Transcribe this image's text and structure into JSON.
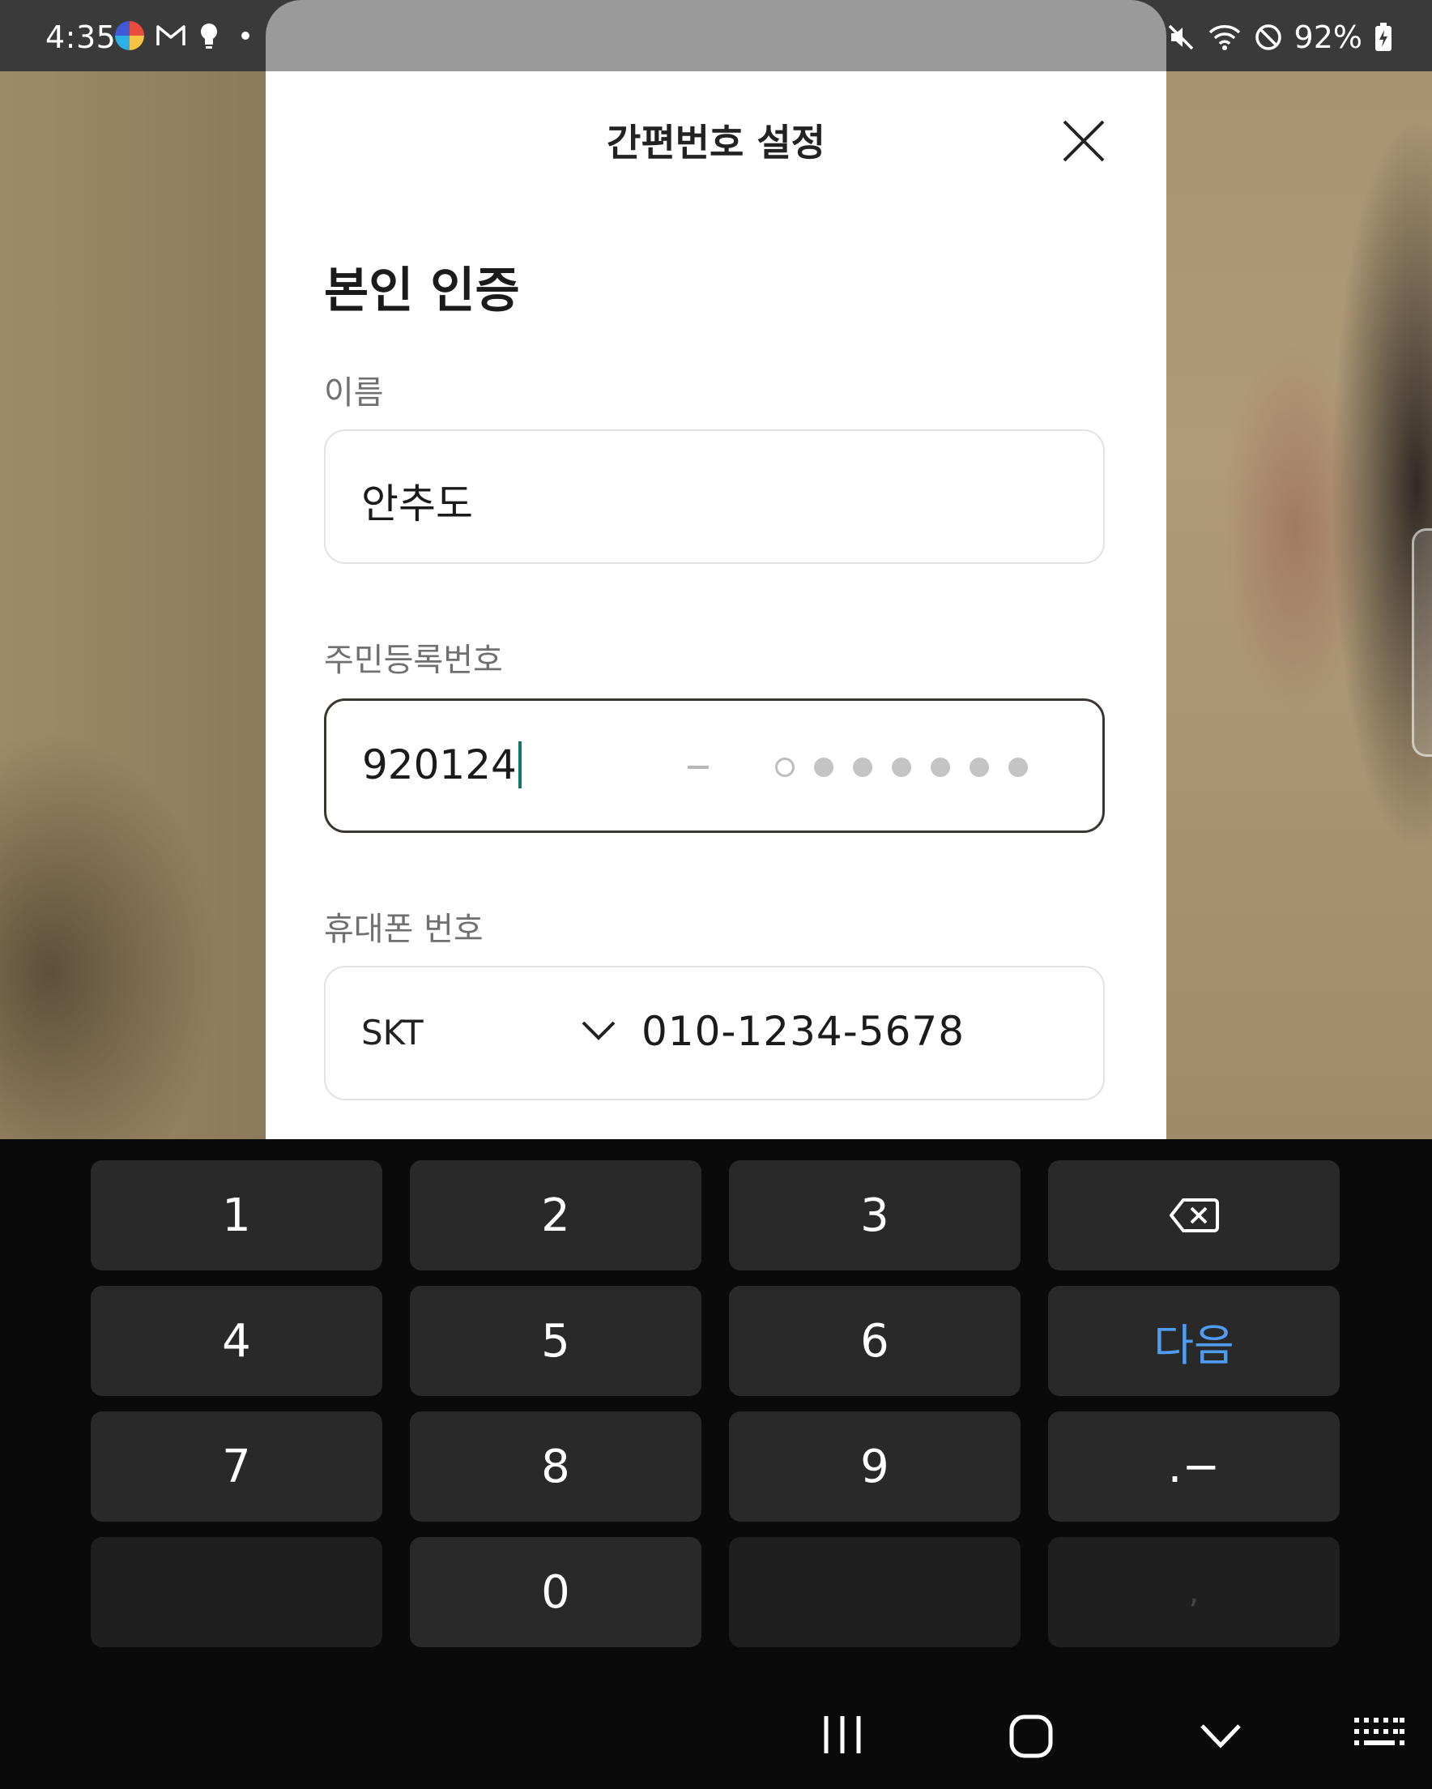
{
  "status_bar": {
    "time": "4:35",
    "battery": "92%",
    "left_icons": [
      "chrome-app-icon",
      "gmail-icon",
      "bulb-icon",
      "dot-icon"
    ],
    "right_icons": [
      "mute-icon",
      "wifi-icon",
      "do-not-disturb-icon",
      "battery-charging-icon"
    ]
  },
  "modal": {
    "title": "간편번호 설정",
    "section_title": "본인 인증",
    "name_field": {
      "label": "이름",
      "value": "안추도"
    },
    "rrn_field": {
      "label": "주민등록번호",
      "front": "920124",
      "back_dots_total": 7,
      "back_dots_filled": 6
    },
    "phone_field": {
      "label": "휴대폰 번호",
      "carrier": "SKT",
      "number": "010-1234-5678"
    }
  },
  "keyboard": {
    "keys": [
      "1",
      "2",
      "3",
      "4",
      "5",
      "6",
      "7",
      "8",
      "9",
      "0"
    ],
    "next_label": "다음",
    "symbol_label": ".−",
    "comma_label": ","
  },
  "colors": {
    "accent_next": "#4f9cf0",
    "cursor": "#0f7a6b",
    "key_bg": "#292929"
  }
}
